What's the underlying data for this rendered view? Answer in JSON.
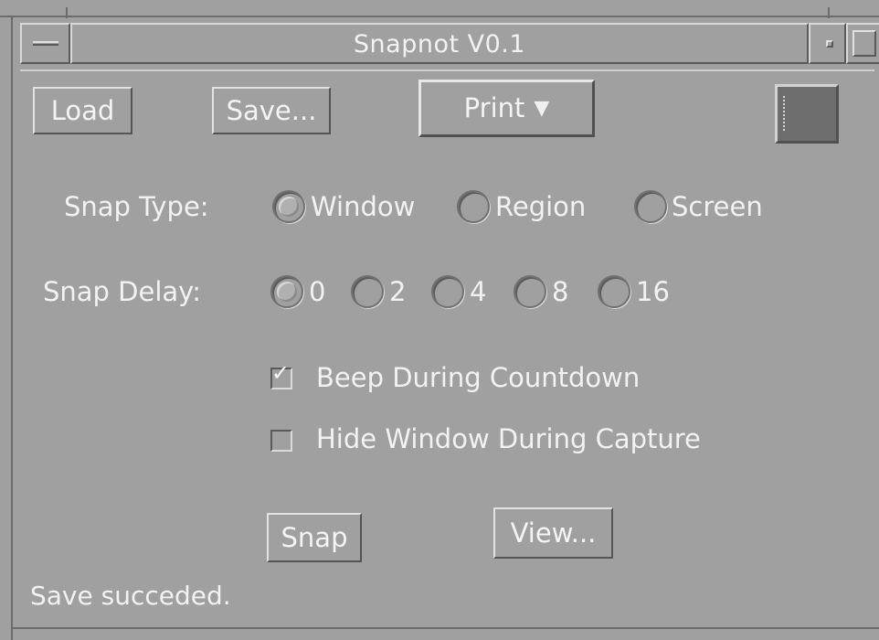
{
  "window": {
    "title": "Snapnot V0.1"
  },
  "toolbar": {
    "load_label": "Load",
    "save_label": "Save...",
    "print_label": "Print",
    "print_arrow": "▼"
  },
  "snap_type": {
    "label": "Snap Type:",
    "options": [
      "Window",
      "Region",
      "Screen"
    ],
    "selected": "Window"
  },
  "snap_delay": {
    "label": "Snap Delay:",
    "options": [
      "0",
      "2",
      "4",
      "8",
      "16"
    ],
    "selected": "0"
  },
  "options": {
    "beep_label": "Beep During Countdown",
    "beep_checked": true,
    "hide_label": "Hide Window During Capture",
    "hide_checked": false,
    "check_mark": "✓"
  },
  "actions": {
    "snap_label": "Snap",
    "view_label": "View..."
  },
  "status": {
    "text": "Save succeded."
  }
}
